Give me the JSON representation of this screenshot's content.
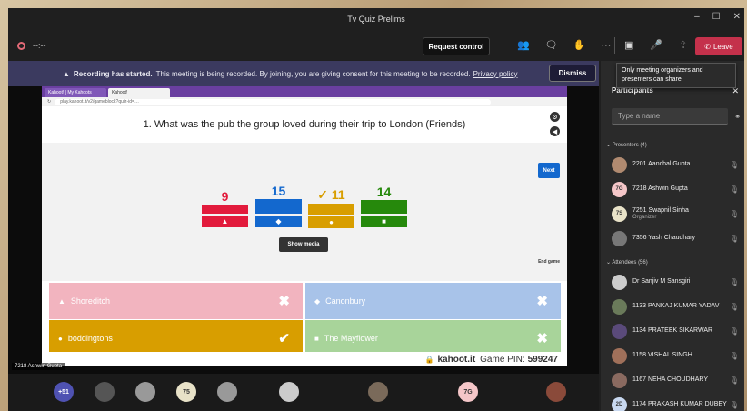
{
  "window": {
    "title": "Tv Quiz Prelims",
    "controls": [
      "–",
      "☐",
      "✕"
    ]
  },
  "toolbar": {
    "timer": "--:--",
    "request_control": "Request control",
    "leave": "Leave"
  },
  "tooltip": "Only meeting organizers and presenters can share",
  "banner": {
    "title": "Recording has started.",
    "text": "This meeting is being recorded. By joining, you are giving consent for this meeting to be recorded.",
    "link": "Privacy policy",
    "dismiss": "Dismiss"
  },
  "shared_screen": {
    "tabs": [
      "Kahoot! | My Kahoots",
      "Kahoot!"
    ],
    "address": "play.kahoot.it/v2/gameblock?quiz-id=…",
    "question": "1.   What was the pub the group loved during their trip to London (Friends)",
    "next": "Next",
    "show_media": "Show media",
    "end_game": "End game",
    "bars": [
      {
        "count": "9",
        "shape": "▲",
        "color": "#e21b3c",
        "correct": false,
        "fill": 0.6
      },
      {
        "count": "15",
        "shape": "◆",
        "color": "#1368ce",
        "correct": false,
        "fill": 1.0
      },
      {
        "count": "✓ 11",
        "shape": "●",
        "color": "#d89e00",
        "correct": true,
        "fill": 0.73
      },
      {
        "count": "14",
        "shape": "■",
        "color": "#26890c",
        "correct": false,
        "fill": 0.93
      }
    ],
    "answers": [
      {
        "shape": "▲",
        "label": "Shoreditch",
        "mark": "✖"
      },
      {
        "shape": "◆",
        "label": "Canonbury",
        "mark": "✖"
      },
      {
        "shape": "●",
        "label": "boddingtons",
        "mark": "✔"
      },
      {
        "shape": "■",
        "label": "The Mayflower",
        "mark": "✖"
      }
    ],
    "brand": "kahoot.it",
    "pin_label": "Game PIN:",
    "pin": "599247",
    "presenter_tag": "7218 Ashwin Gupta"
  },
  "panel": {
    "title": "Participants",
    "search_placeholder": "Type a name",
    "presenters_header": "Presenters (4)",
    "presenters": [
      {
        "name": "2201 Aanchal Gupta",
        "initials": "",
        "color": "#b08a70",
        "sub": ""
      },
      {
        "name": "7218 Ashwin Gupta",
        "initials": "7G",
        "color": "#f4c6c8",
        "sub": ""
      },
      {
        "name": "7251 Swapnil Sinha",
        "initials": "7S",
        "color": "#e8e2c8",
        "sub": "Organizer"
      },
      {
        "name": "7356 Yash Chaudhary",
        "initials": "",
        "color": "#777",
        "sub": ""
      }
    ],
    "attendees_header": "Attendees (56)",
    "attendees": [
      {
        "name": "Dr Sanjiv M Sansgiri",
        "initials": "",
        "color": "#ccc"
      },
      {
        "name": "1133 PANKAJ KUMAR YADAV",
        "initials": "",
        "color": "#6a7a5a"
      },
      {
        "name": "1134 PRATEEK SIKARWAR",
        "initials": "",
        "color": "#5a4a7a"
      },
      {
        "name": "1158 VISHAL SINGH",
        "initials": "",
        "color": "#a0705a"
      },
      {
        "name": "1167 NEHA CHOUDHARY",
        "initials": "",
        "color": "#8a6a60"
      },
      {
        "name": "1174 PRAKASH KUMAR DUBEY",
        "initials": "2D",
        "color": "#c8d8f0"
      }
    ]
  },
  "bottom_bar": {
    "overflow_count": "+51",
    "tiles": [
      {
        "initials": "",
        "color": "#555"
      },
      {
        "initials": "",
        "color": "#999"
      },
      {
        "initials": "75",
        "color": "#e8e2c8"
      },
      {
        "initials": "",
        "color": "#999"
      },
      {
        "initials": "",
        "color": "#ccc"
      },
      {
        "initials": "",
        "color": "#7a6a5a"
      },
      {
        "initials": "7G",
        "color": "#f4c6c8"
      },
      {
        "initials": "",
        "color": "#8a4a3a"
      }
    ]
  }
}
